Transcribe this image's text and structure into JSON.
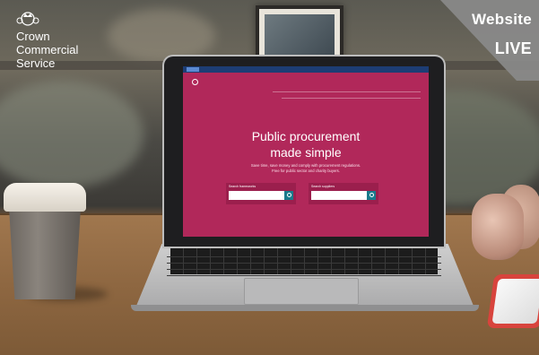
{
  "logo": {
    "lines": [
      "Crown",
      "Commercial",
      "Service"
    ],
    "icon": "crown-crest-icon"
  },
  "badge": {
    "line1": "Website",
    "line2": "LIVE",
    "color": "#8a8a8a"
  },
  "laptop_screen": {
    "accent": "#b1285a",
    "hero_title_line1": "Public procurement",
    "hero_title_line2": "made simple",
    "hero_subtitle_line1": "Save time, save money and comply with procurement regulations.",
    "hero_subtitle_line2": "Free for public sector and charity buyers.",
    "search_left_label": "Search frameworks",
    "search_right_label": "Search suppliers"
  }
}
